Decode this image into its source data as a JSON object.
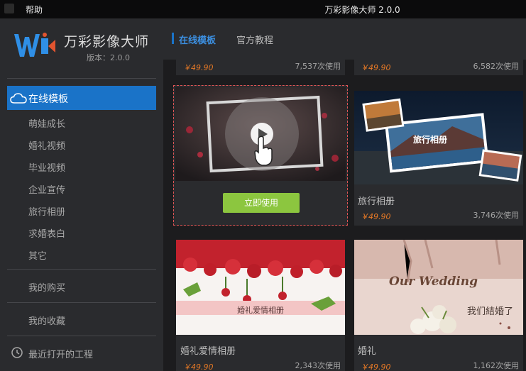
{
  "titlebar": {
    "help_menu": "帮助",
    "app_title": "万彩影像大师 2.0.0"
  },
  "sidebar": {
    "brand_name": "万彩影像大师",
    "version": "版本：2.0.0",
    "active_item": "在线模板",
    "sub_items": [
      "萌娃成长",
      "婚礼视频",
      "毕业视频",
      "企业宣传",
      "旅行相册",
      "求婚表白",
      "其它"
    ],
    "my_purchases": "我的购买",
    "my_favorites": "我的收藏",
    "recent_projects": "最近打开的工程"
  },
  "tabs": {
    "online": "在线模板",
    "tutorial": "官方教程"
  },
  "cards": {
    "top_left": {
      "price": "￥49.90",
      "uses": "7,537次使用"
    },
    "top_right": {
      "price": "￥49.90",
      "uses": "6,582次使用"
    },
    "hover_card": {
      "button": "立即使用"
    },
    "travel": {
      "title": "旅行相册",
      "overlay_text": "旅行相册",
      "price": "￥49.90",
      "uses": "3,746次使用"
    },
    "wedding_album": {
      "title": "婚礼爱情相册",
      "overlay_text": "婚礼爱情相册",
      "price": "￥49.90",
      "uses": "2,343次使用"
    },
    "wedding": {
      "title": "婚礼",
      "overlay_title": "Our Wedding",
      "overlay_text": "我们結婚了",
      "price": "￥49.90",
      "uses": "1,162次使用"
    }
  },
  "colors": {
    "accent_blue": "#1a73c8",
    "price_orange": "#e87a26",
    "use_button_green": "#8cc63f",
    "hover_border_red": "#e05454"
  }
}
